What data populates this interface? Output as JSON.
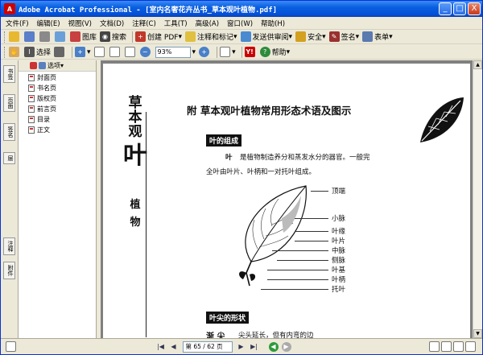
{
  "window": {
    "title": "Adobe Acrobat Professional - [室内名奢花卉丛书_草本观叶植物.pdf]",
    "app_icon": "adobe-acrobat-icon",
    "minimize": "_",
    "maximize": "□",
    "close": "X"
  },
  "menu": [
    "文件(F)",
    "编辑(E)",
    "视图(V)",
    "文档(D)",
    "注释(C)",
    "工具(T)",
    "高级(A)",
    "窗口(W)",
    "帮助(H)"
  ],
  "toolbar1": {
    "search_label": "搜索",
    "organize_label": "图库",
    "create_pdf_label": "创建 PDF",
    "comment_label": "注释和标记",
    "review_label": "发送供审阅",
    "secure_label": "安全",
    "sign_label": "签名",
    "forms_label": "表单"
  },
  "toolbar2": {
    "select_label": "选择",
    "zoom_value": "93%",
    "help_label": "帮助"
  },
  "left_tabs": [
    "书签",
    "页面",
    "签名",
    "层",
    "注释",
    "附件"
  ],
  "bookmarks": {
    "options_label": "选项",
    "items": [
      "封面页",
      "书名页",
      "版权页",
      "前言页",
      "目录",
      "正文"
    ]
  },
  "page": {
    "side_title_chars": [
      "草",
      "本",
      "观",
      "叶"
    ],
    "side_subtitle_chars": [
      "植",
      "物"
    ],
    "heading": "附  草本观叶植物常用形态术语及图示",
    "section1": "叶的组成",
    "para_term": "叶",
    "para_line1": "是植物制造养分和蒸发水分的器官。一般完",
    "para_line2": "全叶由叶片、叶柄和一对托叶组成。",
    "labels": [
      "顶端",
      "小脉",
      "叶缘",
      "叶片",
      "中脉",
      "侧脉",
      "叶基",
      "叶柄",
      "托叶"
    ],
    "section2": "叶尖的形状",
    "bottom_term": "渐 尖",
    "bottom_text": "尖头延长，但有内弯的边"
  },
  "status": {
    "page_indicator": "第 65 / 62 页"
  }
}
